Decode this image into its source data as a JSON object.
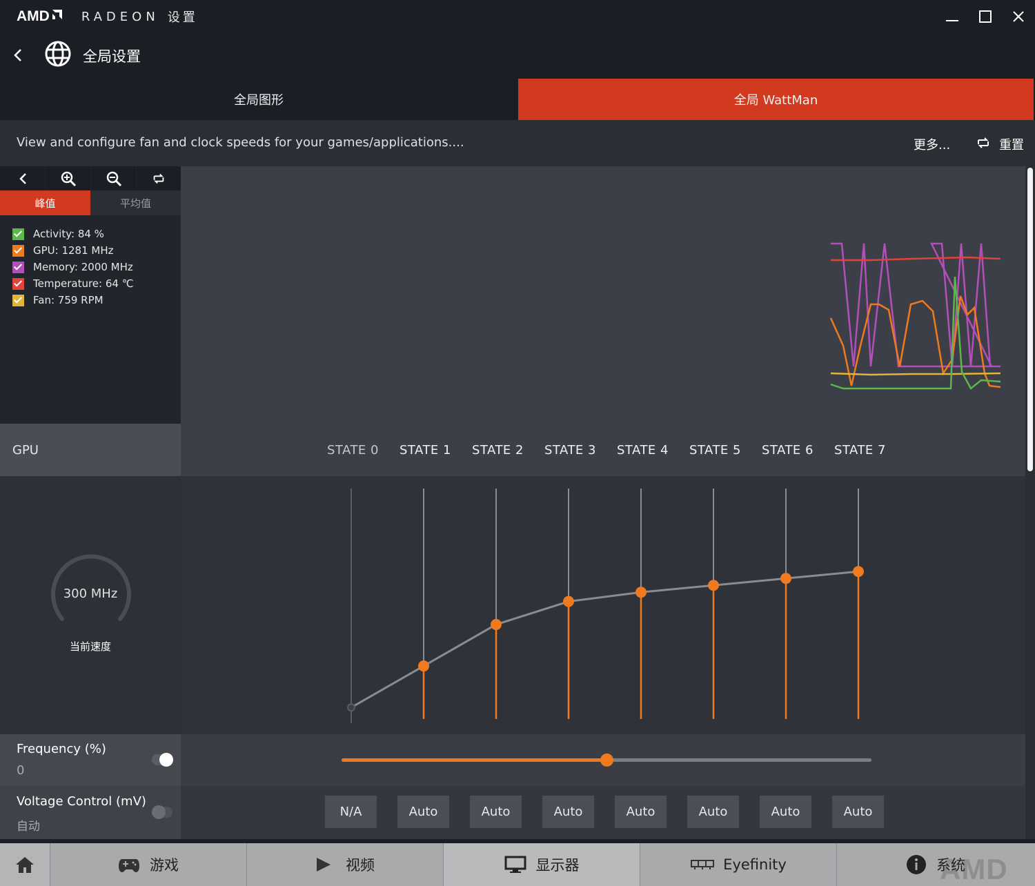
{
  "titlebar": {
    "brand": "AMD",
    "product": "RADEON",
    "settings_word": "设置",
    "minimize_icon": "minimize-icon",
    "maximize_icon": "maximize-icon",
    "close_icon": "close-icon"
  },
  "nav": {
    "title": "全局设置",
    "back_icon": "back-arrow-icon",
    "globe_icon": "globe-icon"
  },
  "tabs": [
    {
      "label": "全局图形",
      "active": false
    },
    {
      "label": "全局 WattMan",
      "active": true
    }
  ],
  "info": {
    "description": "View and configure fan and clock speeds for your games/applications....",
    "more_label": "更多...",
    "reset_label": "重置"
  },
  "monitor": {
    "tabs": [
      {
        "label": "峰值",
        "active": true
      },
      {
        "label": "平均值",
        "active": false
      }
    ],
    "legend": [
      {
        "label": "Activity: 84 %",
        "color": "#5cb84a"
      },
      {
        "label": "GPU: 1281 MHz",
        "color": "#f07a1e"
      },
      {
        "label": "Memory: 2000 MHz",
        "color": "#b24fb8"
      },
      {
        "label": "Temperature: 64 ℃",
        "color": "#e0443a"
      },
      {
        "label": "Fan: 759 RPM",
        "color": "#e0b53a"
      }
    ]
  },
  "gpu": {
    "section_label": "GPU",
    "states": [
      "STATE 0",
      "STATE 1",
      "STATE 2",
      "STATE 3",
      "STATE 4",
      "STATE 5",
      "STATE 6",
      "STATE 7"
    ],
    "current_speed": "300 MHz",
    "current_speed_label": "当前速度",
    "state_levels": [
      0.05,
      0.23,
      0.41,
      0.51,
      0.55,
      0.58,
      0.61,
      0.64
    ]
  },
  "frequency": {
    "label": "Frequency (%)",
    "value": "0",
    "slider_fraction": 0.5,
    "toggle_on": true
  },
  "voltage": {
    "label": "Voltage Control (mV)",
    "value": "自动",
    "toggle_on": false,
    "buttons": [
      "N/A",
      "Auto",
      "Auto",
      "Auto",
      "Auto",
      "Auto",
      "Auto",
      "Auto"
    ]
  },
  "bottom_nav": [
    {
      "label": "",
      "icon": "home-icon"
    },
    {
      "label": "游戏",
      "icon": "gamepad-icon"
    },
    {
      "label": "视频",
      "icon": "play-icon"
    },
    {
      "label": "显示器",
      "icon": "monitor-icon"
    },
    {
      "label": "Eyefinity",
      "icon": "eyefinity-icon"
    },
    {
      "label": "系统",
      "icon": "info-icon"
    }
  ],
  "colors": {
    "accent": "#d13a1f",
    "orange": "#f07a1e"
  }
}
